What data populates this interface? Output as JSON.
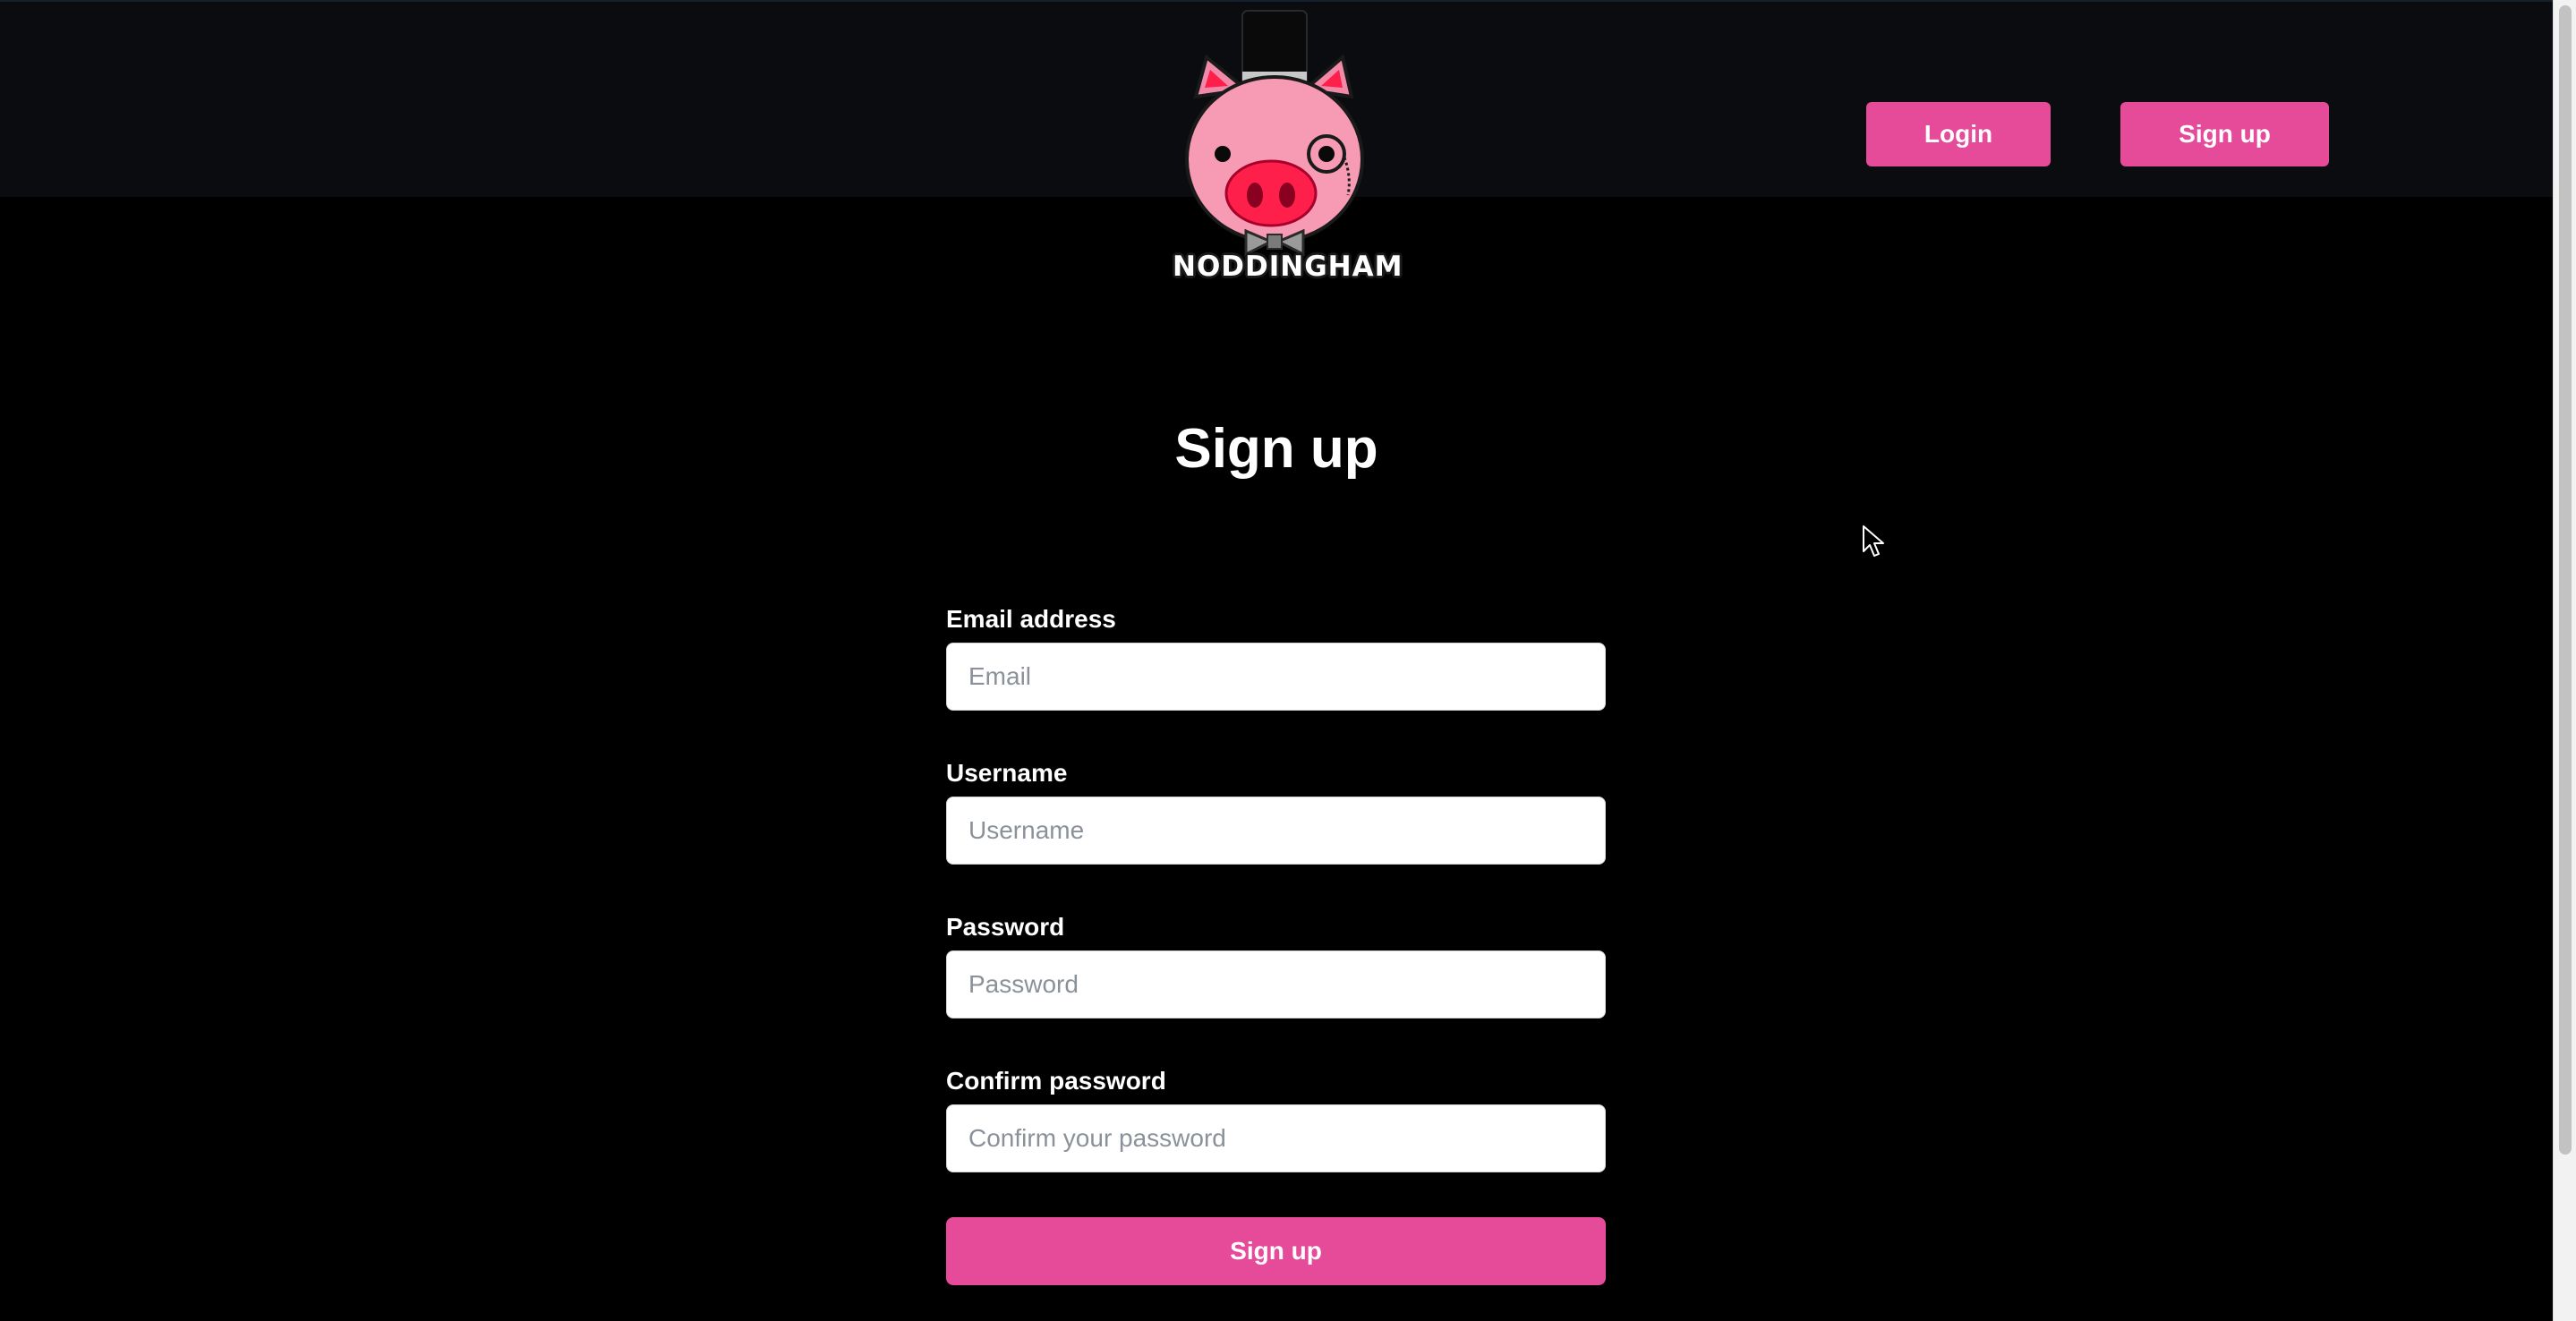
{
  "header": {
    "logo_text": "NODDINGHAM",
    "login_label": "Login",
    "signup_label": "Sign up"
  },
  "main": {
    "title": "Sign up",
    "fields": [
      {
        "label": "Email address",
        "placeholder": "Email",
        "value": ""
      },
      {
        "label": "Username",
        "placeholder": "Username",
        "value": ""
      },
      {
        "label": "Password",
        "placeholder": "Password",
        "value": ""
      },
      {
        "label": "Confirm password",
        "placeholder": "Confirm your password",
        "value": ""
      }
    ],
    "submit_label": "Sign up"
  },
  "icons": {
    "logo": "pig-top-hat-monocle-logo",
    "cursor": "mouse-pointer-icon"
  },
  "colors": {
    "background": "#000000",
    "header_bg": "#0b0c0f",
    "accent": "#e64b99",
    "input_bg": "#ffffff",
    "placeholder": "#8a9199"
  }
}
